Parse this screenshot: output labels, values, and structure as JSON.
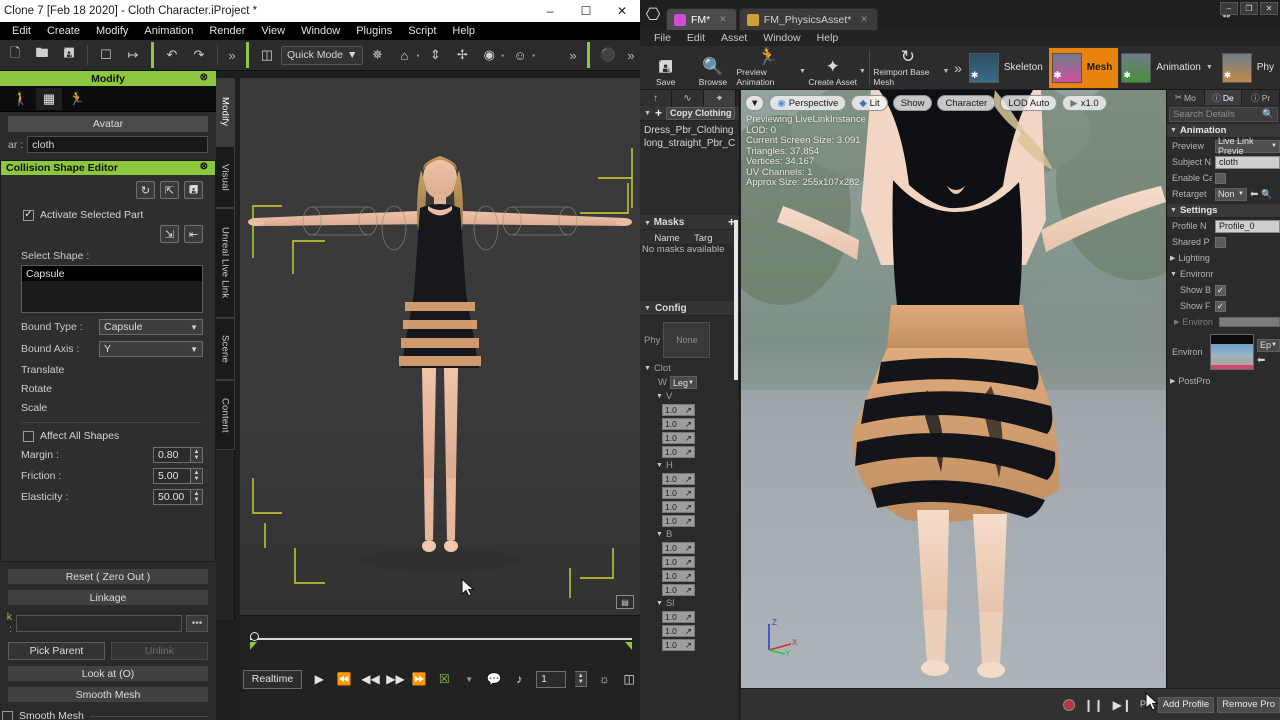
{
  "left_app": {
    "title": "Clone 7 [Feb 18 2020] - Cloth Character.iProject *",
    "window_buttons": {
      "minimize": "–",
      "maximize": "☐",
      "close": "✕"
    },
    "menu": [
      "Edit",
      "Create",
      "Modify",
      "Animation",
      "Render",
      "View",
      "Window",
      "Plugins",
      "Script",
      "Help"
    ],
    "toolbar": {
      "icons": [
        "new-document-icon",
        "open-folder-icon",
        "save-disk-icon",
        "preview-eye-icon",
        "export-icon",
        "undo-icon",
        "redo-icon"
      ],
      "overflow": "»",
      "mode_select": "Quick Mode",
      "right_icons": [
        "light-icon",
        "home-icon",
        "height-icon",
        "move-icon",
        "camera-icon",
        "face-icon"
      ],
      "overflow2": "»"
    },
    "panel": {
      "header": "Modify",
      "close": "⊗",
      "mode_icons": [
        "pose-icon",
        "checker-icon",
        "motion-icon"
      ],
      "avatar_button": "Avatar",
      "avatar_label": "ar :",
      "avatar_value": "cloth"
    },
    "collision_editor": {
      "header": "Collision Shape Editor",
      "close": "⊗",
      "tool_icons": [
        "refresh-icon",
        "import-icon",
        "save-icon"
      ],
      "activate_checkbox_label": "Activate Selected Part",
      "activate_checked": true,
      "add_icons": [
        "add-shape-icon",
        "remove-shape-icon"
      ],
      "select_shape_label": "Select Shape :",
      "shape_list": [
        "Capsule"
      ],
      "bound_type_label": "Bound Type :",
      "bound_type_value": "Capsule",
      "bound_axis_label": "Bound Axis :",
      "bound_axis_value": "Y",
      "transform_rows": [
        "Translate",
        "Rotate",
        "Scale"
      ],
      "affect_all_label": "Affect All Shapes",
      "affect_all_checked": false,
      "numeric": [
        {
          "label": "Margin :",
          "value": "0.80"
        },
        {
          "label": "Friction :",
          "value": "5.00"
        },
        {
          "label": "Elasticity :",
          "value": "50.00"
        }
      ]
    },
    "lower_panel": {
      "reset_button": "Reset ( Zero Out )",
      "linkage_header": "Linkage",
      "link_key": "k :",
      "link_value": "",
      "dots_button": "•••",
      "pick_parent_button": "Pick Parent",
      "unlink_button": "Unlink",
      "look_at_button": "Look at  (O)",
      "smooth_mesh_button": "Smooth Mesh",
      "smooth_mesh_checkbox_label": "Smooth Mesh"
    },
    "side_tabs": [
      "Modify",
      "Visual",
      "Unreal Live Link",
      "Scene",
      "Content"
    ],
    "side_tab_selected": "Modify",
    "viewport": {
      "background_color": "#3a3a3a",
      "gizmo_color": "#cfd62e",
      "badge_icon": "viewport-layout-icon"
    },
    "timeline": {
      "frame_value": "1",
      "realtime_button": "Realtime",
      "transport_icons": [
        "play-icon",
        "first-frame-icon",
        "prev-frame-icon",
        "next-frame-icon",
        "last-frame-icon",
        "range-icon",
        "comment-icon",
        "note-icon"
      ],
      "tail_icons": [
        "settings-gear-icon",
        "timeline-view-icon"
      ]
    }
  },
  "ue_app": {
    "tabs": [
      {
        "label": "FM*",
        "icon_color": "#d24bd2",
        "active": true
      },
      {
        "label": "FM_PhysicsAsset*",
        "icon_color": "#d0a030",
        "active": false
      }
    ],
    "window_buttons": {
      "minimize": "–",
      "maximize": "❐",
      "close": "✕"
    },
    "recycle_icon": "recycle-bin-icon",
    "menu": [
      "File",
      "Edit",
      "Asset",
      "Window",
      "Help"
    ],
    "toolbar": [
      {
        "label": "Save",
        "icon": "save-icon"
      },
      {
        "label": "Browse",
        "icon": "magnifier-icon"
      },
      {
        "label": "Preview Animation",
        "icon": "run-figure-icon",
        "has_dropdown": true
      },
      {
        "label": "Create Asset",
        "icon": "create-asset-icon",
        "has_dropdown": true
      },
      {
        "label": "Reimport Base Mesh",
        "icon": "reimport-icon",
        "has_dropdown": true
      }
    ],
    "toolbar_overflow": "»",
    "modes": [
      {
        "label": "Skeleton",
        "active": false,
        "accent": "#2a7fa8"
      },
      {
        "label": "Mesh",
        "active": true,
        "accent": "#e8830c"
      },
      {
        "label": "Animation",
        "active": false,
        "accent": "#4a8f3c",
        "has_dropdown": true
      },
      {
        "label": "Phy",
        "active": false,
        "accent": "#c08a4a"
      }
    ],
    "left_panel": {
      "tabs": [
        "clothing-icon",
        "curve-icon",
        "asset-icon"
      ],
      "selected_tab_index": 2,
      "clothing_header": "Copy Clothing",
      "clothing_items": [
        "Dress_Pbr_Clothing",
        "long_straight_Pbr_C"
      ],
      "masks_header": "Masks",
      "masks_columns": [
        "Name",
        "Targ"
      ],
      "masks_empty": "No masks available",
      "config_header": "Config",
      "config_phys_label": "Phy",
      "config_phys_value": "None",
      "config_cloth_label": "Clot",
      "config_w_label": "W",
      "config_w_value": "Leg",
      "config_groups": [
        {
          "label": "V",
          "values": [
            "1.0",
            "1.0",
            "1.0",
            "1.0"
          ]
        },
        {
          "label": "H",
          "values": [
            "1.0",
            "1.0",
            "1.0",
            "1.0"
          ]
        },
        {
          "label": "B",
          "values": [
            "1.0",
            "1.0",
            "1.0",
            "1.0"
          ]
        },
        {
          "label": "Sl",
          "values": [
            "1.0",
            "1.0",
            "1.0"
          ]
        }
      ]
    },
    "viewport": {
      "buttons": [
        "Perspective",
        "Lit",
        "Show",
        "Character",
        "LOD Auto",
        "x1.0"
      ],
      "dropdown_icon": "viewport-options-icon",
      "stats": [
        "Previewing LiveLinkInstance",
        "LOD: 0",
        "Current Screen Size: 3.091",
        "Triangles: 37,854",
        "Vertices: 34,167",
        "UV Channels: 1",
        "Approx Size: 255x107x282"
      ],
      "axis_labels": [
        "Z",
        "X",
        "Y"
      ]
    },
    "details": {
      "tabs": [
        "Mo",
        "De",
        "Pr"
      ],
      "selected_tab_index": 1,
      "search_placeholder": "Search Details",
      "search_icon": "search-icon",
      "sections": [
        {
          "title": "Animation",
          "rows": [
            {
              "label": "Preview",
              "type": "dropdown",
              "value": "Live Link Previe"
            },
            {
              "label": "Subject N",
              "type": "input",
              "value": "cloth"
            },
            {
              "label": "Enable Ca",
              "type": "checkbox",
              "checked": false
            },
            {
              "label": "Retarget",
              "type": "dropdown-small",
              "value": "Non"
            }
          ]
        },
        {
          "title": "Settings",
          "rows": [
            {
              "label": "Profile N",
              "type": "input",
              "value": "Profile_0"
            },
            {
              "label": "Shared P",
              "type": "checkbox",
              "checked": false
            },
            {
              "label": "Lighting",
              "type": "collapsed"
            },
            {
              "label": "Environr",
              "type": "expanded"
            },
            {
              "label": "Show B",
              "type": "checkbox",
              "checked": true,
              "indent": true
            },
            {
              "label": "Show F",
              "type": "checkbox",
              "checked": true,
              "indent": true
            },
            {
              "label": "Environ",
              "type": "bar",
              "indent": true,
              "disabled": true
            },
            {
              "label": "Environ",
              "type": "thumbnail",
              "dropdown": "Ep"
            },
            {
              "label": "PostPro",
              "type": "collapsed"
            }
          ]
        }
      ]
    },
    "bottom_bar": {
      "record_icon": "record-icon",
      "pause_icon": "pause-icon",
      "step_icon": "step-icon",
      "profile_label": "Pro",
      "add_profile_button": "Add Profile",
      "remove_profile_button": "Remove Pro"
    }
  }
}
